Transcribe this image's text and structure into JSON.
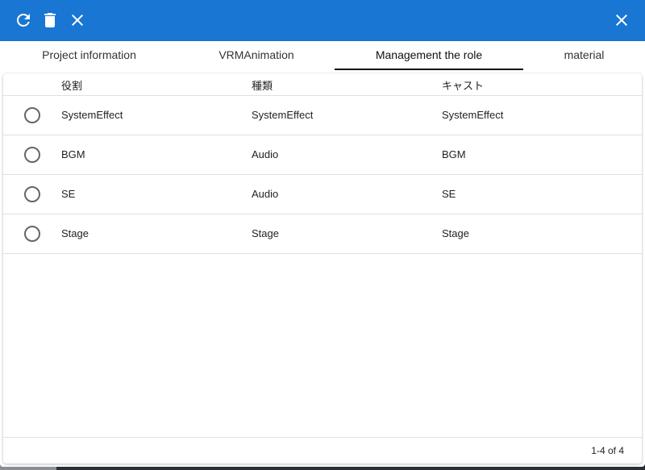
{
  "toolbar": {
    "refresh_icon": "refresh-icon",
    "delete_icon": "trash-icon",
    "clear_icon": "close-icon",
    "close_icon": "close-icon",
    "color": "#1976d2"
  },
  "tabs": [
    {
      "label": "Project information",
      "active": false
    },
    {
      "label": "VRMAnimation",
      "active": false
    },
    {
      "label": "Management the role",
      "active": true
    },
    {
      "label": "material",
      "active": false
    }
  ],
  "table": {
    "columns": [
      "役割",
      "種類",
      "キャスト"
    ],
    "rows": [
      {
        "role": "SystemEffect",
        "type": "SystemEffect",
        "cast": "SystemEffect"
      },
      {
        "role": "BGM",
        "type": "Audio",
        "cast": "BGM"
      },
      {
        "role": "SE",
        "type": "Audio",
        "cast": "SE"
      },
      {
        "role": "Stage",
        "type": "Stage",
        "cast": "Stage"
      }
    ]
  },
  "pagination": {
    "text": "1-4 of 4"
  }
}
